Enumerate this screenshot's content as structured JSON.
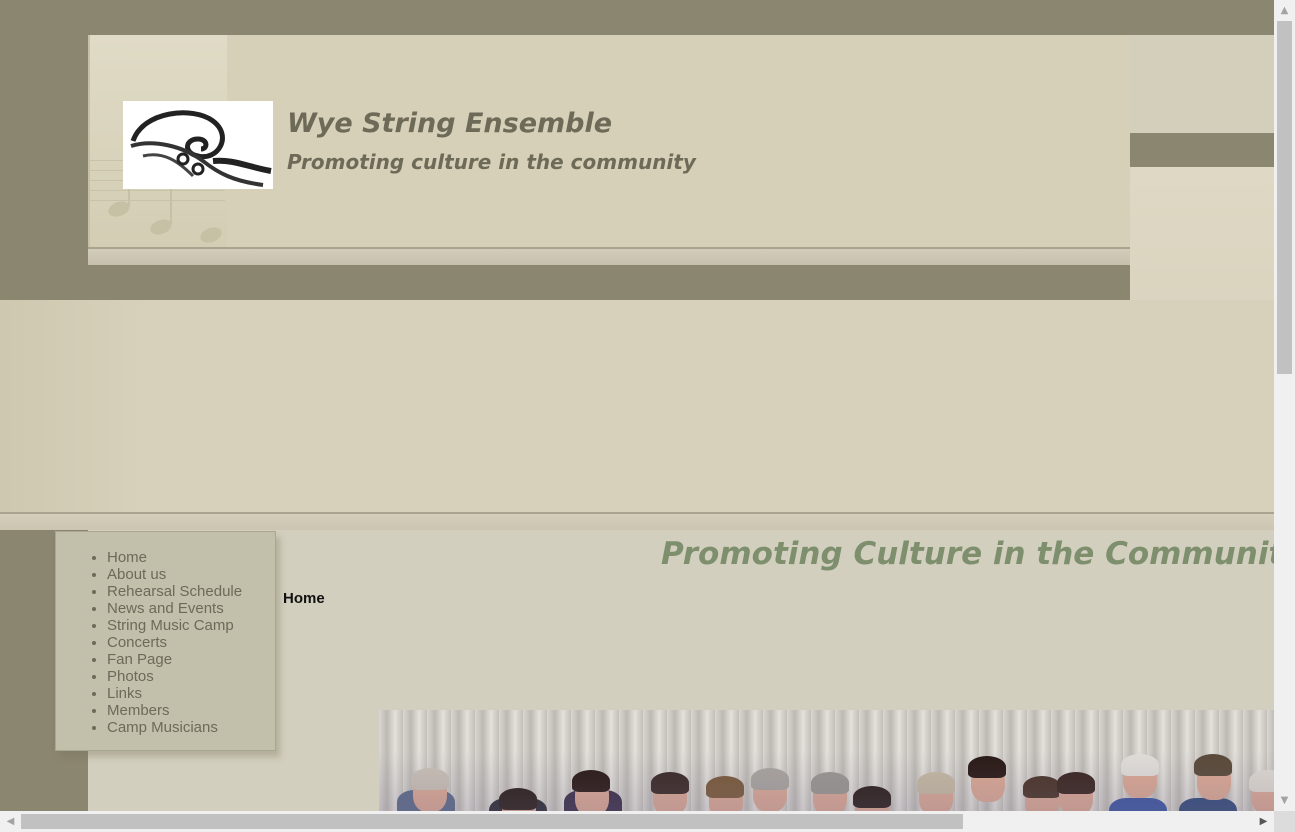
{
  "header": {
    "site_title": "Wye String Ensemble",
    "site_slogan": "Promoting culture in the community"
  },
  "nav": {
    "items": [
      {
        "label": "Home"
      },
      {
        "label": "About us"
      },
      {
        "label": "Rehearsal Schedule"
      },
      {
        "label": "News and Events"
      },
      {
        "label": "String Music Camp"
      },
      {
        "label": "Concerts"
      },
      {
        "label": "Fan Page"
      },
      {
        "label": "Photos"
      },
      {
        "label": "Links"
      },
      {
        "label": "Members"
      },
      {
        "label": "Camp Musicians"
      }
    ]
  },
  "main": {
    "heading": "Promoting Culture in the Community",
    "breadcrumb": "Home"
  },
  "scrollbars": {
    "up_arrow": "▲",
    "down_arrow": "▼",
    "left_arrow": "◀",
    "right_arrow": "▶"
  },
  "colors": {
    "dark_band": "#8b8670",
    "header_bg": "#d6d0b8",
    "title_text": "#6e6a58",
    "heading_green": "#7e8f6e",
    "nav_bg": "#c2bfab"
  }
}
